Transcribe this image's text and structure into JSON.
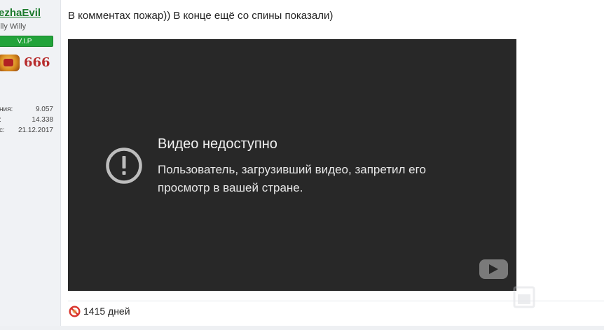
{
  "user": {
    "name": "ezhaEvil",
    "title": "illy Willy",
    "badge": "V.I.P",
    "rank_number": "666",
    "stats": [
      {
        "label": "ния:",
        "value": "9.057"
      },
      {
        "label": ":",
        "value": "14.338"
      },
      {
        "label": "с:",
        "value": "21.12.2017"
      }
    ]
  },
  "post": {
    "text": "В комментах пожар)) В конце ещё со спины показали)"
  },
  "video": {
    "title": "Видео недоступно",
    "message": "Пользователь, загрузивший видео, запретил его просмотр в вашей стране.",
    "icon": "alert-circle-icon",
    "logo": "youtube-logo-icon",
    "background": "#282828"
  },
  "footer": {
    "icon": "no-entry-icon",
    "online_text": "1415 дней"
  },
  "colors": {
    "username": "#1b7a2c",
    "badge": "#22a33a",
    "rank": "#b72c2c"
  }
}
